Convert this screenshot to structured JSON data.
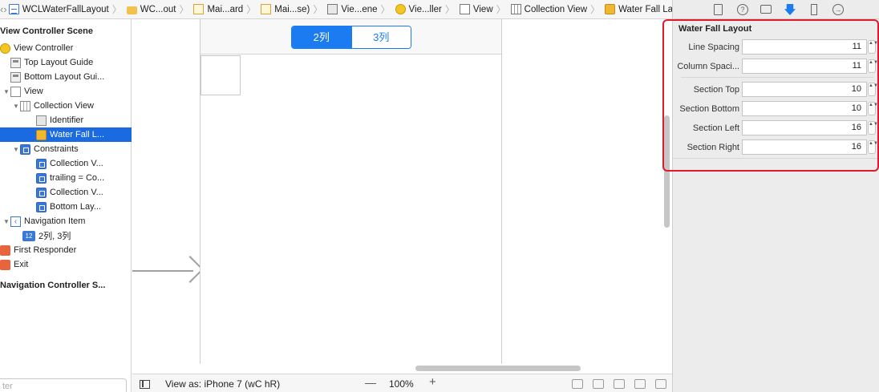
{
  "breadcrumb": [
    {
      "label": "WCLWaterFallLayout",
      "icon": "swift-file-icon"
    },
    {
      "label": "WC...out",
      "icon": "folder-icon"
    },
    {
      "label": "Mai...ard",
      "icon": "storyboard-icon"
    },
    {
      "label": "Mai...se)",
      "icon": "storyboard-icon"
    },
    {
      "label": "Vie...ene",
      "icon": "scene-icon"
    },
    {
      "label": "Vie...ller",
      "icon": "view-controller-icon"
    },
    {
      "label": "View",
      "icon": "view-icon"
    },
    {
      "label": "Collection View",
      "icon": "collection-view-icon"
    },
    {
      "label": "Water Fall Layout",
      "icon": "layout-object-icon"
    }
  ],
  "outline": {
    "scene_header": "View Controller Scene",
    "items": [
      {
        "label": "View Controller",
        "indent": 0,
        "icon": "view-controller-icon"
      },
      {
        "label": "Top Layout Guide",
        "indent": 1,
        "icon": "layout-guide-icon"
      },
      {
        "label": "Bottom Layout Gui...",
        "indent": 1,
        "icon": "layout-guide-icon"
      },
      {
        "label": "View",
        "indent": 1,
        "icon": "view-icon"
      },
      {
        "label": "Collection View",
        "indent": 2,
        "icon": "collection-view-icon"
      },
      {
        "label": "Identifier",
        "indent": 3,
        "icon": "cell-icon"
      },
      {
        "label": "Water Fall L...",
        "indent": 3,
        "icon": "layout-object-icon"
      },
      {
        "label": "Constraints",
        "indent": 2,
        "icon": "constraints-icon"
      },
      {
        "label": "Collection V...",
        "indent": 3,
        "icon": "constraint-icon"
      },
      {
        "label": "trailing = Co...",
        "indent": 3,
        "icon": "constraint-icon"
      },
      {
        "label": "Collection V...",
        "indent": 3,
        "icon": "constraint-icon"
      },
      {
        "label": "Bottom Lay...",
        "indent": 3,
        "icon": "constraint-icon"
      },
      {
        "label": "Navigation Item",
        "indent": 1,
        "icon": "navigation-item-icon"
      },
      {
        "label": "2列, 3列",
        "indent": 2,
        "icon": "segmented-control-icon"
      },
      {
        "label": "First Responder",
        "indent": 0,
        "icon": "first-responder-icon"
      },
      {
        "label": "Exit",
        "indent": 0,
        "icon": "exit-icon"
      }
    ],
    "scene2_header": "Navigation Controller S...",
    "filter_placeholder": "ter"
  },
  "canvas": {
    "segments": [
      "2列",
      "3列"
    ],
    "selected_segment": 0
  },
  "bottombar": {
    "view_as": "View as: iPhone 7 (wC hR)",
    "zoom_out": "—",
    "zoom": "100%",
    "zoom_in": "+"
  },
  "inspector": {
    "section_title": "Water Fall Layout",
    "properties": [
      {
        "label": "Line Spacing",
        "value": "11"
      },
      {
        "label": "Column Spaci...",
        "value": "11"
      },
      {
        "label": "Section Top",
        "value": "10"
      },
      {
        "label": "Section Bottom",
        "value": "10"
      },
      {
        "label": "Section Left",
        "value": "16"
      },
      {
        "label": "Section Right",
        "value": "16"
      }
    ],
    "stepper_glyph": "▲▼"
  },
  "colors": {
    "selection": "#1a6be2",
    "accent": "#1a7cf0",
    "highlight": "#e0192b"
  }
}
